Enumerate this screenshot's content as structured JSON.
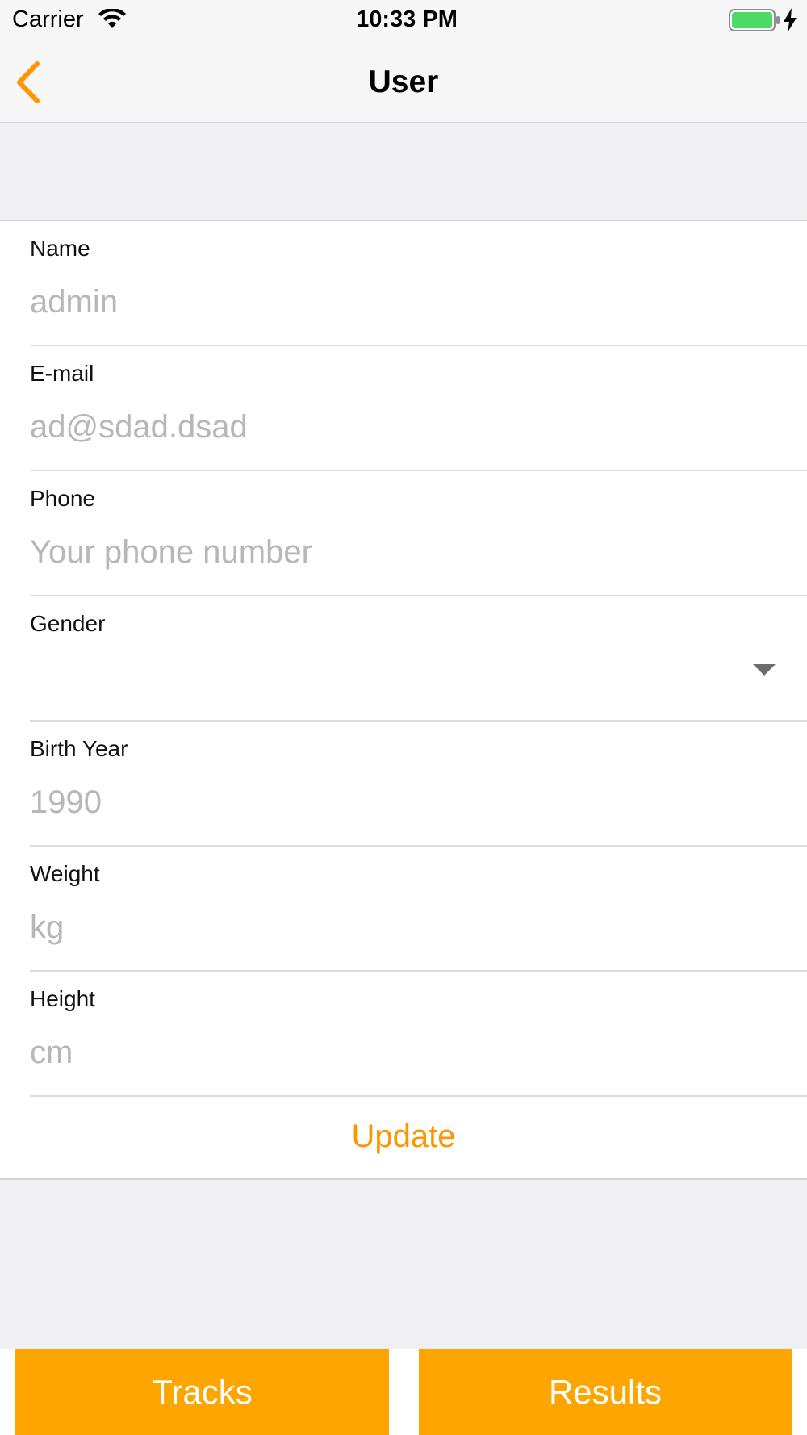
{
  "status_bar": {
    "carrier": "Carrier",
    "time": "10:33 PM"
  },
  "nav": {
    "title": "User",
    "back_icon": "chevron-left-icon"
  },
  "colors": {
    "accent": "#ff9500",
    "tab_button": "#ffa500",
    "placeholder": "#b6b6bb"
  },
  "form": {
    "fields": [
      {
        "label": "Name",
        "placeholder": "admin"
      },
      {
        "label": "E-mail",
        "placeholder": "ad@sdad.dsad"
      },
      {
        "label": "Phone",
        "placeholder": "Your phone number"
      },
      {
        "label": "Gender",
        "placeholder": ""
      },
      {
        "label": "Birth Year",
        "placeholder": "1990"
      },
      {
        "label": "Weight",
        "placeholder": "kg"
      },
      {
        "label": "Height",
        "placeholder": "cm"
      }
    ],
    "update_label": "Update"
  },
  "tabbar": {
    "tracks_label": "Tracks",
    "results_label": "Results"
  }
}
